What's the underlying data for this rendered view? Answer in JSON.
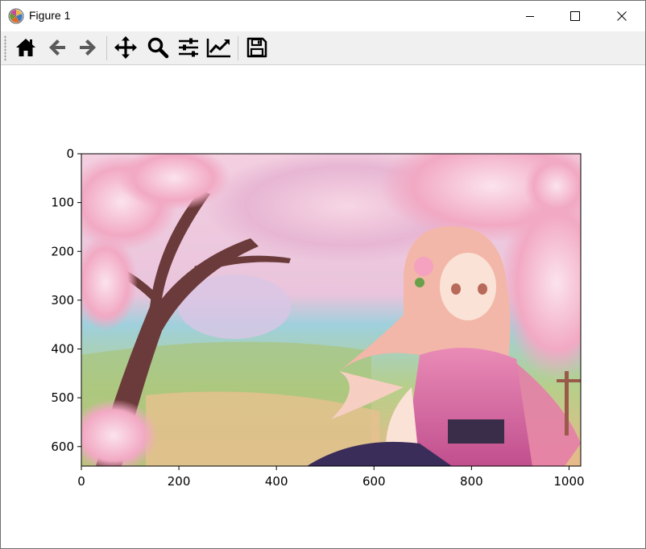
{
  "window": {
    "title": "Figure 1",
    "controls": {
      "minimize": "minimize-icon",
      "maximize": "maximize-icon",
      "close": "close-icon"
    }
  },
  "toolbar": {
    "buttons": [
      {
        "name": "home-button",
        "icon": "home-icon"
      },
      {
        "name": "back-button",
        "icon": "arrow-left-icon"
      },
      {
        "name": "forward-button",
        "icon": "arrow-right-icon"
      },
      {
        "name": "pan-button",
        "icon": "move-icon"
      },
      {
        "name": "zoom-button",
        "icon": "magnifier-icon"
      },
      {
        "name": "configure-subplots-button",
        "icon": "sliders-icon"
      },
      {
        "name": "edit-axes-button",
        "icon": "line-chart-icon"
      },
      {
        "name": "save-button",
        "icon": "floppy-disk-icon"
      }
    ]
  },
  "axes": {
    "content": "image",
    "x_ticks": [
      "0",
      "200",
      "400",
      "600",
      "800",
      "1000"
    ],
    "y_ticks": [
      "0",
      "100",
      "200",
      "300",
      "400",
      "500",
      "600"
    ],
    "x_range": [
      0,
      1024
    ],
    "y_range": [
      640,
      0
    ]
  }
}
